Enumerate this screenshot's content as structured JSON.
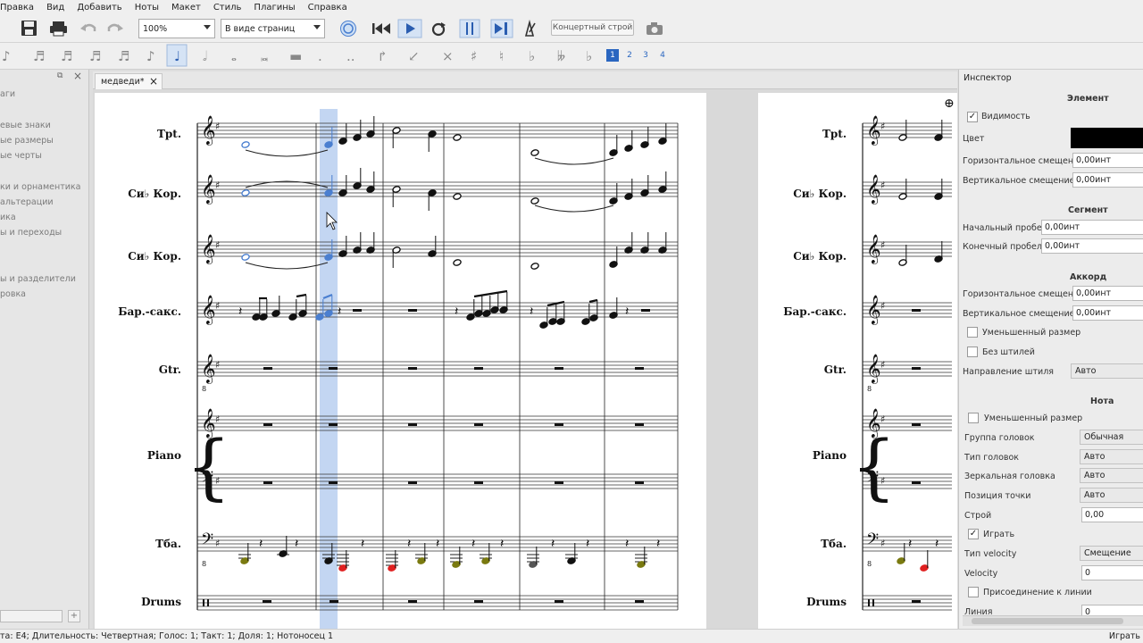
{
  "menu": [
    "Правка",
    "Вид",
    "Добавить",
    "Ноты",
    "Макет",
    "Стиль",
    "Плагины",
    "Справка"
  ],
  "toolbar": {
    "zoom": "100%",
    "view_mode": "В виде страниц",
    "concert_pitch": "Концертный строй",
    "voices": [
      "1",
      "2",
      "3",
      "4"
    ]
  },
  "left_panel": {
    "items": [
      "аги",
      "",
      "евые знаки",
      "ые размеры",
      "ые черты",
      "",
      "ки и орнаментика",
      "альтерации",
      "ика",
      "ы и переходы",
      "",
      "ы и разделители",
      "ровка"
    ]
  },
  "tab": {
    "title": "медведи*"
  },
  "score": {
    "instruments": [
      "Tpt.",
      "Си♭ Кор.",
      "Си♭ Кор.",
      "Бар.-сакс.",
      "Gtr.",
      "Piano",
      "Тба.",
      "Drums"
    ],
    "accent_color": "#4a7fd0",
    "selection_color": "#b9cff0"
  },
  "inspector": {
    "title": "Инспектор",
    "element": {
      "header": "Элемент",
      "visibility": "Видимость",
      "color": "Цвет",
      "color_value": "#000000",
      "h_offset_label": "Горизонтальное смещение",
      "h_offset": "0,00инт",
      "v_offset_label": "Вертикальное смещение",
      "v_offset": "0,00инт"
    },
    "segment": {
      "header": "Сегмент",
      "lead_label": "Начальный пробел",
      "lead": "0,00инт",
      "trail_label": "Конечный пробел",
      "trail": "0,00инт"
    },
    "chord": {
      "header": "Аккорд",
      "h_offset_label": "Горизонтальное смещение",
      "h_offset": "0,00инт",
      "v_offset_label": "Вертикальное смещение",
      "v_offset": "0,00инт",
      "small": "Уменьшенный размер",
      "no_stem": "Без штилей",
      "stem_dir_label": "Направление штиля",
      "stem_dir": "Авто"
    },
    "note": {
      "header": "Нота",
      "small": "Уменьшенный размер",
      "head_group_label": "Группа головок",
      "head_group": "Обычная",
      "head_type_label": "Тип головок",
      "head_type": "Авто",
      "mirror_label": "Зеркальная головка",
      "mirror": "Авто",
      "dot_pos_label": "Позиция точки",
      "dot_pos": "Авто",
      "tuning_label": "Строй",
      "tuning": "0,00",
      "play": "Играть",
      "velo_type_label": "Тип velocity",
      "velo_type": "Смещение",
      "velocity_label": "Velocity",
      "velocity": "0",
      "fix_line": "Присоединение к линии",
      "line_label": "Линия",
      "line": "0"
    }
  },
  "status": {
    "left": "та: E4; Длительность: Четвертная; Голос: 1;  Такт: 1; Доля: 1; Нотоносец 1",
    "right": "Играть"
  }
}
